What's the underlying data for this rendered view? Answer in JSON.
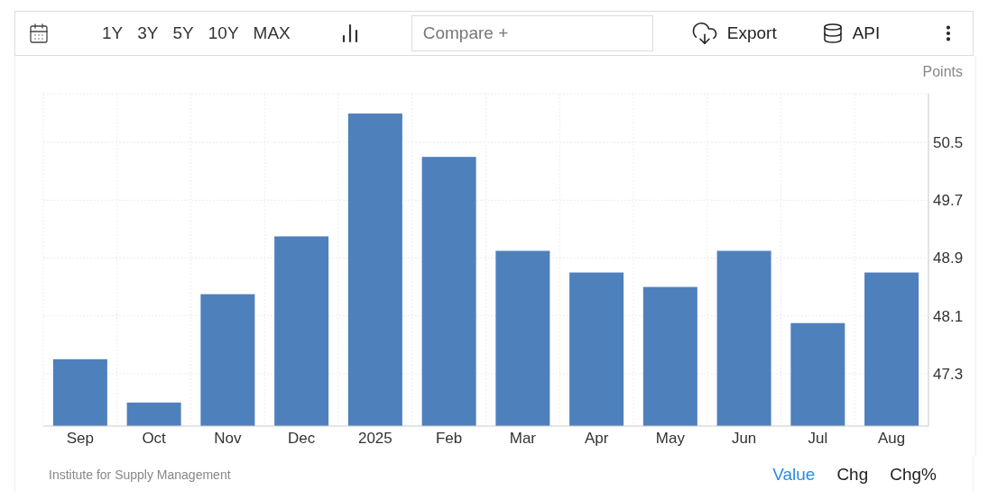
{
  "toolbar": {
    "ranges": [
      {
        "label": "1Y",
        "selected": false
      },
      {
        "label": "3Y",
        "selected": false
      },
      {
        "label": "5Y",
        "selected": false
      },
      {
        "label": "10Y",
        "selected": false
      },
      {
        "label": "MAX",
        "selected": false
      }
    ],
    "compare": {
      "placeholder": "Compare +"
    },
    "export": "Export",
    "api": "API"
  },
  "chart": {
    "chart_data": {
      "type": "bar",
      "ylabel": "Points",
      "categories": [
        "Sep",
        "Oct",
        "Nov",
        "Dec",
        "2025",
        "Feb",
        "Mar",
        "Apr",
        "May",
        "Jun",
        "Jul",
        "Aug"
      ],
      "grid": true,
      "series": [
        {
          "color": "#4e80bc",
          "values": [
            47.5,
            46.9,
            48.4,
            49.2,
            50.9,
            50.3,
            49.0,
            48.7,
            48.5,
            49.0,
            48.0,
            48.7
          ]
        }
      ],
      "ylim": [
        46.575,
        51.175
      ],
      "yticks": [
        47.3,
        48.1,
        48.9,
        49.7,
        50.5
      ]
    }
  },
  "source": "Institute for Supply Management",
  "views": [
    {
      "label": "Value",
      "selected": true
    },
    {
      "label": "Chg",
      "selected": false
    },
    {
      "label": "Chg%",
      "selected": false
    }
  ]
}
